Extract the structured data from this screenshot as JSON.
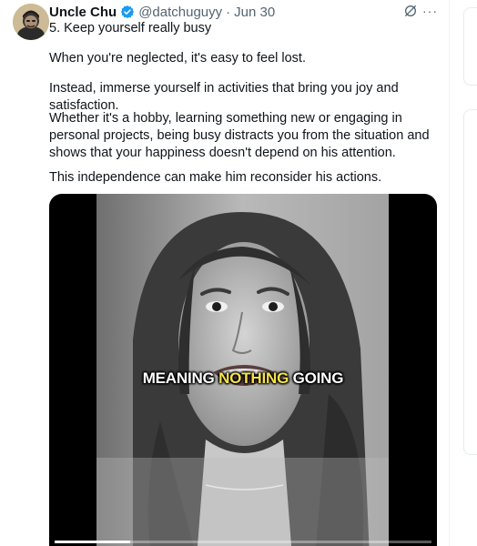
{
  "tweet": {
    "author_name": "Uncle Chu",
    "handle": "@datchuguyy",
    "separator": "·",
    "date": "Jun 30",
    "title_line": "5. Keep yourself really busy",
    "paragraphs": [
      "When you're neglected, it's easy to feel lost.",
      "Instead, immerse yourself in activities that bring you joy and satisfaction.",
      "Whether it's a hobby, learning something new or engaging in personal projects, being busy distracts you from the situation and shows that your happiness doesn't depend on his attention.",
      "This independence can make him reconsider his actions."
    ],
    "icons": {
      "verified": "verified-badge-icon",
      "grok": "grok-icon",
      "more": "more-options-icon"
    },
    "more_glyph": "···"
  },
  "video": {
    "caption_before": "MEANING ",
    "caption_highlight": "NOTHING",
    "caption_after": " GOING",
    "progress_fraction": 0.2,
    "caption_highlight_color": "#f5e24a"
  },
  "colors": {
    "accent_verified": "#1d9bf0",
    "secondary_text": "#536471"
  }
}
